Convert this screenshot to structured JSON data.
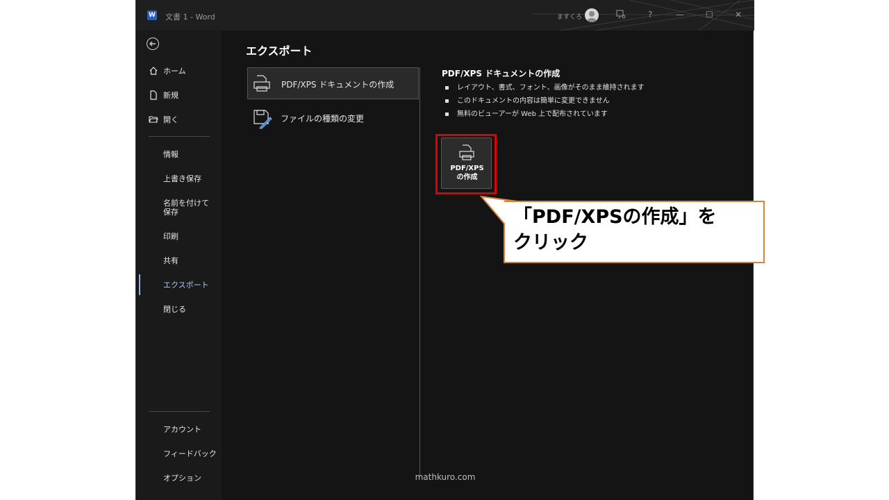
{
  "titlebar": {
    "doc_title": "文書 1 - Word",
    "user_name": "ますくろ",
    "help": "?",
    "minimize": "—",
    "maximize": "☐",
    "close": "✕"
  },
  "sidebar": {
    "top_items": [
      {
        "label": "ホーム",
        "icon": "home-icon"
      },
      {
        "label": "新規",
        "icon": "new-document-icon"
      },
      {
        "label": "開く",
        "icon": "open-folder-icon"
      }
    ],
    "mid_items": [
      "情報",
      "上書き保存",
      "名前を付けて保存",
      "印刷",
      "共有",
      "エクスポート",
      "閉じる"
    ],
    "active_item": "エクスポート",
    "bottom_items": [
      "アカウント",
      "フィードバック",
      "オプション"
    ]
  },
  "main": {
    "title": "エクスポート",
    "options": [
      {
        "label": "PDF/XPS ドキュメントの作成",
        "icon": "pdf-document-icon",
        "selected": true
      },
      {
        "label": "ファイルの種類の変更",
        "icon": "change-file-type-icon",
        "selected": false
      }
    ]
  },
  "detail": {
    "title": "PDF/XPS ドキュメントの作成",
    "bullets": [
      "レイアウト、書式、フォント、画像がそのまま維持されます",
      "このドキュメントの内容は簡単に変更できません",
      "無料のビューアーが Web 上で配布されています"
    ],
    "create_button": "PDF/XPS\nの作成"
  },
  "watermark": "mathkuro.com",
  "callout": {
    "text": "「PDF/XPSの作成」を\nクリック"
  },
  "colors": {
    "highlight": "#e00000",
    "callout_border": "#d9823b",
    "active_accent": "#8ab4f8",
    "word_blue": "#2b5fb8"
  }
}
